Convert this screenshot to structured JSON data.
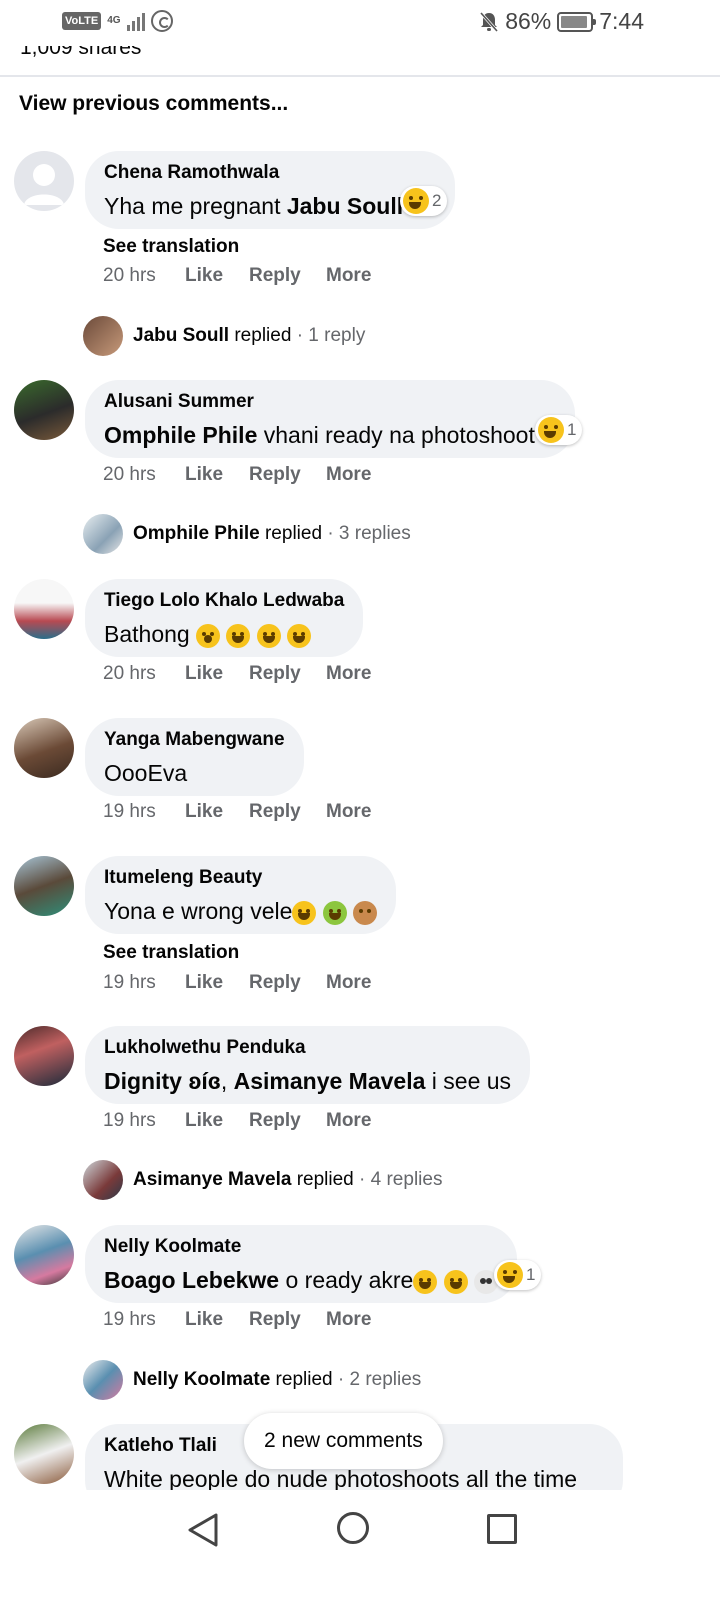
{
  "status_bar": {
    "volte": "VoLTE",
    "network": "4G",
    "battery": "86%",
    "time": "7:44",
    "icons": [
      "volte-icon",
      "signal-icon",
      "whatsapp-icon",
      "mute-bell-icon",
      "battery-icon"
    ]
  },
  "post": {
    "shares": "1,009 shares"
  },
  "view_previous": "View previous comments...",
  "comments": [
    {
      "author": "Chena Ramothwala",
      "text_plain": "Yha me pregnant ",
      "mention": "Jabu Soull",
      "reaction_count": "2",
      "see_translation": "See translation",
      "time": "20 hrs",
      "like": "Like",
      "reply": "Reply",
      "more": "More",
      "replies": {
        "name": "Jabu Soull",
        "verb": "replied",
        "count": "· 1 reply"
      }
    },
    {
      "author": "Alusani Summer",
      "mention": "Omphile Phile",
      "text_plain": " vhani ready na photoshoot",
      "reaction_count": "1",
      "time": "20 hrs",
      "like": "Like",
      "reply": "Reply",
      "more": "More",
      "replies": {
        "name": "Omphile Phile",
        "verb": "replied",
        "count": "· 3 replies"
      }
    },
    {
      "author": "Tiego Lolo Khalo Ledwaba",
      "text_plain": "Bathong ",
      "time": "20 hrs",
      "like": "Like",
      "reply": "Reply",
      "more": "More"
    },
    {
      "author": "Yanga Mabengwane",
      "text_plain": "OooEva",
      "time": "19 hrs",
      "like": "Like",
      "reply": "Reply",
      "more": "More"
    },
    {
      "author": "Itumeleng Beauty",
      "text_plain": "Yona e wrong vele",
      "see_translation": "See translation",
      "time": "19 hrs",
      "like": "Like",
      "reply": "Reply",
      "more": "More"
    },
    {
      "author": "Lukholwethu Penduka",
      "mention": "Dignity ʚíɞ",
      "sep": ", ",
      "mention2": "Asimanye Mavela",
      "text_plain": " i see us",
      "time": "19 hrs",
      "like": "Like",
      "reply": "Reply",
      "more": "More",
      "replies": {
        "name": "Asimanye Mavela",
        "verb": "replied",
        "count": "· 4 replies"
      }
    },
    {
      "author": "Nelly Koolmate",
      "mention": "Boago Lebekwe",
      "text_plain": " o ready akre",
      "reaction_count": "1",
      "time": "19 hrs",
      "like": "Like",
      "reply": "Reply",
      "more": "More",
      "replies": {
        "name": "Nelly Koolmate",
        "verb": "replied",
        "count": "· 2 replies"
      }
    },
    {
      "author": "Katleho Tlali",
      "text_plain": "White people do nude photoshoots all the time"
    }
  ],
  "new_comments": "2 new comments",
  "colors": {
    "bubble": "#f0f2f5",
    "meta": "#65676b",
    "text": "#050505"
  }
}
